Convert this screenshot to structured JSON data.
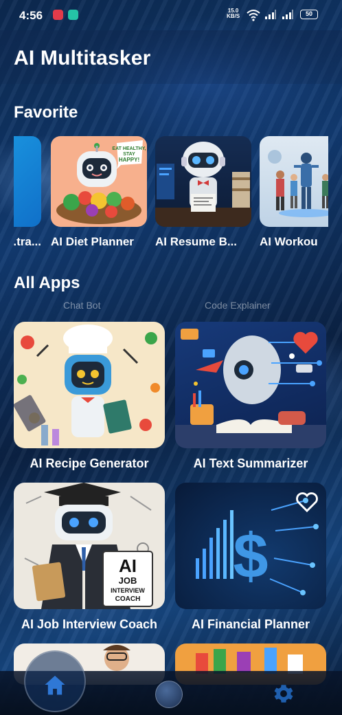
{
  "status_bar": {
    "time": "4:56",
    "net_speed": "15.0",
    "net_unit": "KB/S",
    "battery": "50"
  },
  "header": {
    "title": "AI Multitasker"
  },
  "favorites": {
    "title": "Favorite",
    "items": [
      {
        "label": "...tra...",
        "icon": "partial-app-thumb"
      },
      {
        "label": "AI Diet Planner",
        "icon": "robot-chef-salad-image",
        "badge": "EAT HEALTHY, STAY HAPPY!"
      },
      {
        "label": "AI Resume B...",
        "icon": "robot-bowtie-resume-image"
      },
      {
        "label": "AI Workou",
        "icon": "workout-people-image"
      }
    ]
  },
  "all_apps": {
    "title": "All Apps",
    "faded_labels": [
      "Chat Bot",
      "Code Explainer"
    ],
    "items": [
      {
        "label": "AI Recipe Generator",
        "icon": "robot-chef-image"
      },
      {
        "label": "AI Text Summarizer",
        "icon": "robot-reading-book-image",
        "favorited": true
      },
      {
        "label": "AI Job Interview Coach",
        "icon": "robot-graduate-image",
        "sign": [
          "AI",
          "JOB",
          "INTERVIEW",
          "COACH"
        ]
      },
      {
        "label": "AI Financial Planner",
        "icon": "dollar-circuit-image",
        "favorited": false
      }
    ]
  },
  "bottom_nav": {
    "items": [
      {
        "name": "home",
        "icon": "home-icon",
        "active": true
      },
      {
        "name": "profile",
        "icon": "avatar-icon",
        "active": false
      },
      {
        "name": "settings",
        "icon": "gear-icon",
        "active": false
      }
    ]
  },
  "colors": {
    "accent": "#2f78d6",
    "heart_active": "#e84a3c",
    "heart_outline": "#ffffff"
  }
}
